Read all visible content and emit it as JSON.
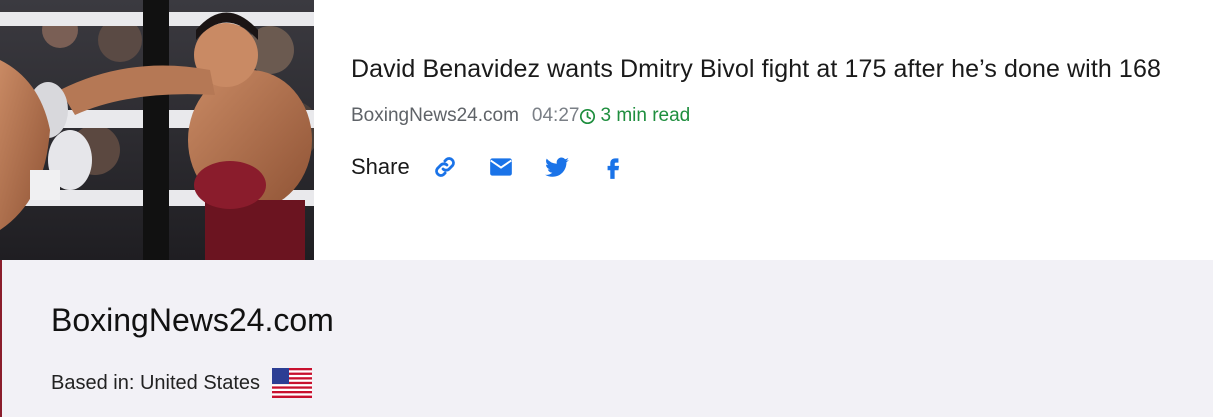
{
  "article": {
    "image_alt": "Boxer throwing a punch in the ring",
    "headline": "David Benavidez wants Dmitry Bivol fight at 175 after he’s done with 168",
    "source": "BoxingNews24.com",
    "time": "04:27",
    "read_time": "3 min read",
    "share_label": "Share"
  },
  "share_icons": [
    "link-icon",
    "email-icon",
    "twitter-icon",
    "facebook-icon"
  ],
  "publisher": {
    "name": "BoxingNews24.com",
    "based_in": "Based in: United States",
    "flag": "us-flag-icon"
  },
  "colors": {
    "share_blue": "#1a73e8",
    "read_green": "#1e8e3e",
    "panel_bg": "#f2f1f6"
  }
}
